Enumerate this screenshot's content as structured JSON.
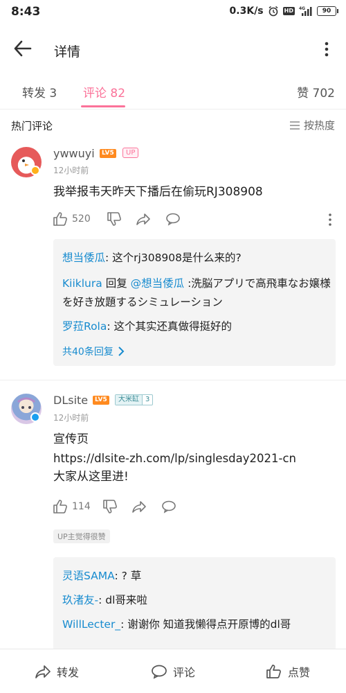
{
  "status_bar": {
    "time": "8:43",
    "net_speed": "0.3K/s",
    "hd": "HD",
    "signal_label": "4G",
    "battery": "90"
  },
  "header": {
    "title": "详情"
  },
  "tabs": {
    "forward": "转发 3",
    "comments": "评论 82",
    "likes": "赞 702"
  },
  "section": {
    "title": "热门评论",
    "sort_label": "按热度"
  },
  "comments": [
    {
      "username": "ywwuyi",
      "level": "LV5",
      "tag": "UP",
      "time": "12小时前",
      "text": "我举报韦天昨天下播后在偷玩RJ308908",
      "like_count": "520",
      "replies": [
        {
          "name": "想当倭瓜",
          "text": ": 这个rj308908是什么来的?"
        },
        {
          "name": "Kiiklura",
          "middle": " 回复 ",
          "mention": "@想当倭瓜",
          "text": " :洗脳アプリで高飛車なお嬢様を好き放題するシミュレーション"
        },
        {
          "name": "罗菈Rola",
          "text": ": 这个其实还真做得挺好的"
        }
      ],
      "more_replies": "共40条回复"
    },
    {
      "username": "DLsite",
      "level": "LV5",
      "fan_badge": {
        "name": "大米缸",
        "level": "3"
      },
      "time": "12小时前",
      "text_lines": [
        "宣传页",
        "https://dlsite-zh.com/lp/singlesday2021-cn",
        "大家从这里进!"
      ],
      "like_count": "114",
      "up_liked": "UP主觉得很赞",
      "replies": [
        {
          "name": "灵语SAMA",
          "text": ": ? 草"
        },
        {
          "name": "玖渚友-",
          "text": ": dl哥来啦"
        },
        {
          "name": "WillLecter_",
          "text": ": 谢谢你 知道我懒得点开原博的dl哥"
        }
      ]
    }
  ],
  "bottom_bar": {
    "forward": "转发",
    "comment": "评论",
    "like": "点赞"
  },
  "colors": {
    "accent_pink": "#fb7299",
    "link_blue": "#178bcf",
    "level_orange": "#ff8a1f"
  }
}
